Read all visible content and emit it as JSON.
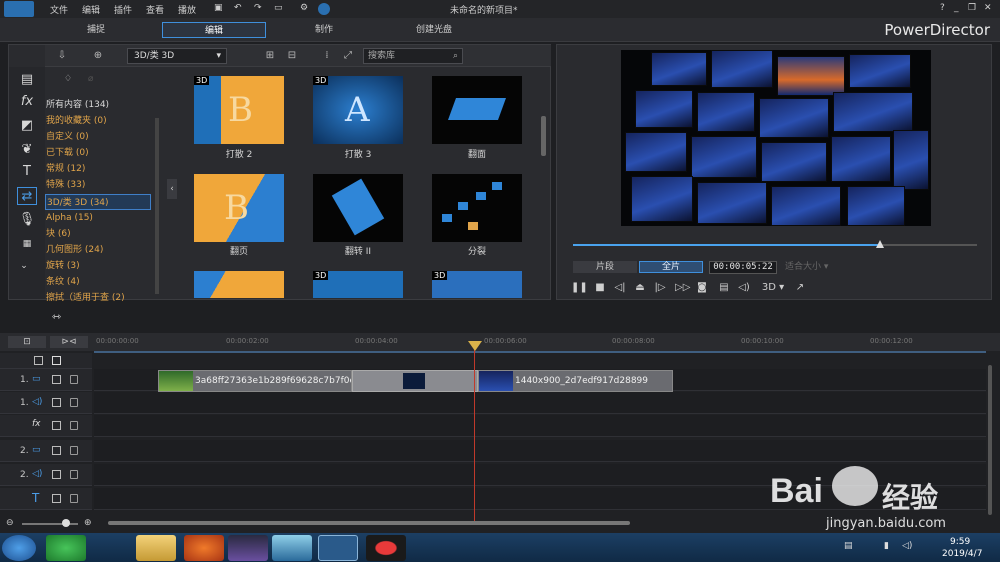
{
  "titlebar": {
    "menus": [
      "文件",
      "编辑",
      "插件",
      "查看",
      "播放"
    ],
    "title": "未命名的新项目*",
    "help": "?"
  },
  "modes": {
    "capture": "捕捉",
    "edit": "编辑",
    "produce": "制作",
    "disc": "创建光盘"
  },
  "brand": "PowerDirector",
  "library": {
    "dropdown": "3D/类 3D",
    "search_placeholder": "搜索库",
    "categories": [
      "所有内容 (134)",
      "我的收藏夹 (0)",
      "自定义 (0)",
      "已下载 (0)",
      "常规 (12)",
      "特殊 (33)",
      "3D/类 3D (34)",
      "Alpha (15)",
      "块 (6)",
      "几何图形 (24)",
      "旋转 (3)",
      "条纹 (4)",
      "擦拭（适用于查 (2)"
    ],
    "thumbs": [
      {
        "label": "打散 2",
        "tag": "3D"
      },
      {
        "label": "打散 3",
        "tag": "3D"
      },
      {
        "label": "翻面",
        "tag": ""
      },
      {
        "label": "翻页",
        "tag": ""
      },
      {
        "label": "翻转 II",
        "tag": ""
      },
      {
        "label": "分裂",
        "tag": ""
      },
      {
        "label": "",
        "tag": ""
      },
      {
        "label": "",
        "tag": "3D"
      },
      {
        "label": "",
        "tag": "3D"
      }
    ]
  },
  "preview": {
    "clip_label": "片段",
    "movie_label": "全片",
    "timecode": "00:00:05:22",
    "fit_label": "适合大小",
    "mode_3d": "3D",
    "progress": 0.76
  },
  "timeline": {
    "ruler": [
      "00:00:00:00",
      "00:00:02:00",
      "00:00:04:00",
      "00:00:06:00",
      "00:00:08:00",
      "00:00:10:00",
      "00:00:12:00"
    ],
    "clip1": "3a68ff27363e1b289f69628c7b7f0e0f",
    "clip2": "1440x900_2d7edf917d28899",
    "tracks": [
      "1.",
      "1.",
      "",
      "2.",
      "2.",
      ""
    ]
  },
  "taskbar": {
    "time": "9:59",
    "date": "2019/4/7"
  },
  "watermark": {
    "line1": "Bai",
    "line2": "经验",
    "url": "jingyan.baidu.com"
  },
  "colors": {
    "accent": "#3f8fdc",
    "category": "#e0a44a",
    "playhead": "#c0392b"
  }
}
